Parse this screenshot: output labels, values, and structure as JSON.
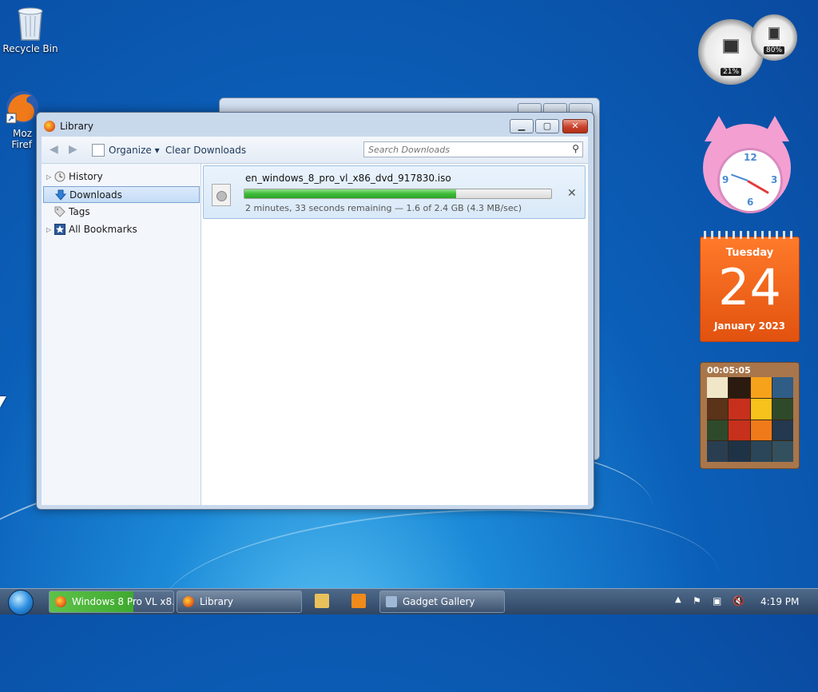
{
  "desktop": {
    "recycle_bin_label": "Recycle Bin",
    "firefox_label_line1": "Moz",
    "firefox_label_line2": "Firef"
  },
  "library_window": {
    "title": "Library",
    "toolbar": {
      "organize_label": "Organize",
      "clear_downloads_label": "Clear Downloads",
      "search_placeholder": "Search Downloads"
    },
    "sidebar": {
      "items": [
        {
          "label": "History",
          "icon": "clock-icon",
          "expandable": true
        },
        {
          "label": "Downloads",
          "icon": "download-arrow-icon",
          "expandable": false,
          "selected": true
        },
        {
          "label": "Tags",
          "icon": "tag-icon",
          "expandable": false
        },
        {
          "label": "All Bookmarks",
          "icon": "bookmark-star-icon",
          "expandable": true
        }
      ]
    },
    "downloads": [
      {
        "filename": "en_windows_8_pro_vl_x86_dvd_917830.iso",
        "progress_fraction": 0.69,
        "status": "2 minutes, 33 seconds remaining — 1.6 of 2.4 GB (4.3 MB/sec)"
      }
    ]
  },
  "gadgets": {
    "cpu_meter": {
      "cpu_percent": "21%",
      "memory_percent": "80%"
    },
    "clock": {
      "numerals": [
        "12",
        "3",
        "6",
        "9"
      ]
    },
    "calendar": {
      "weekday": "Tuesday",
      "day": "24",
      "month_year": "January 2023"
    },
    "puzzle": {
      "timer": "00:05:05"
    }
  },
  "taskbar": {
    "tasks": [
      {
        "label": "Windows 8 Pro VL x8..."
      },
      {
        "label": "Library"
      },
      {
        "label": "Gadget Gallery"
      }
    ],
    "clock": "4:19 PM"
  },
  "colors": {
    "progress_green": "#3dbb37",
    "close_button_red": "#c8412c",
    "calendar_orange": "#e1520f",
    "selection_blue": "#c4dcf6"
  }
}
